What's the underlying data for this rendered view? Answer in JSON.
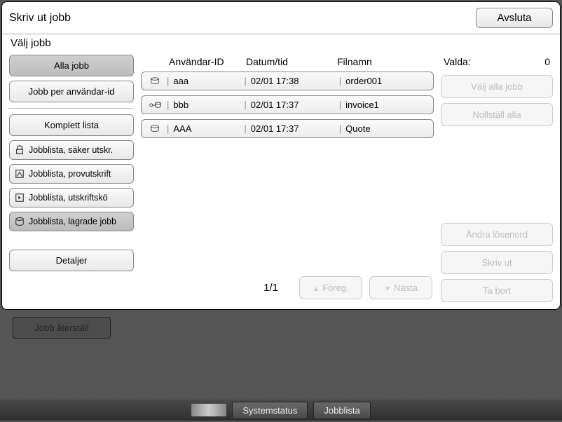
{
  "title": "Skriv ut jobb",
  "exit_label": "Avsluta",
  "subtitle": "Välj jobb",
  "left": {
    "all_jobs": "Alla jobb",
    "per_user": "Jobb per användar-id",
    "complete_list": "Komplett lista",
    "filters": [
      {
        "icon": "lock",
        "label": "Jobblista, säker utskr."
      },
      {
        "icon": "proof",
        "label": "Jobblista, provutskrift"
      },
      {
        "icon": "queue",
        "label": "Jobblista, utskriftskö"
      },
      {
        "icon": "stored",
        "label": "Jobblista, lagrade jobb"
      }
    ],
    "details": "Detaljer"
  },
  "headers": {
    "user": "Användar-ID",
    "date": "Datum/tid",
    "file": "Filnamn"
  },
  "jobs": [
    {
      "icon": "disc",
      "user": "aaa",
      "date": "02/01 17:38",
      "file": "order001"
    },
    {
      "icon": "key-disc",
      "user": "bbb",
      "date": "02/01 17:37",
      "file": "invoice1"
    },
    {
      "icon": "disc",
      "user": "AAA",
      "date": "02/01 17:37",
      "file": "Quote"
    }
  ],
  "pager": {
    "page": "1/1",
    "prev": "Föreg.",
    "next": "Nästa"
  },
  "right": {
    "selected_label": "Valda:",
    "selected_count": "0",
    "select_all": "Välj alla jobb",
    "reset_all": "Nollställ alla",
    "change_pw": "Ändra lösenord",
    "print": "Skriv ut",
    "delete": "Ta bort"
  },
  "bg_button": "Jobb återställ",
  "bottom": {
    "status": "Systemstatus",
    "joblist": "Jobblista"
  }
}
